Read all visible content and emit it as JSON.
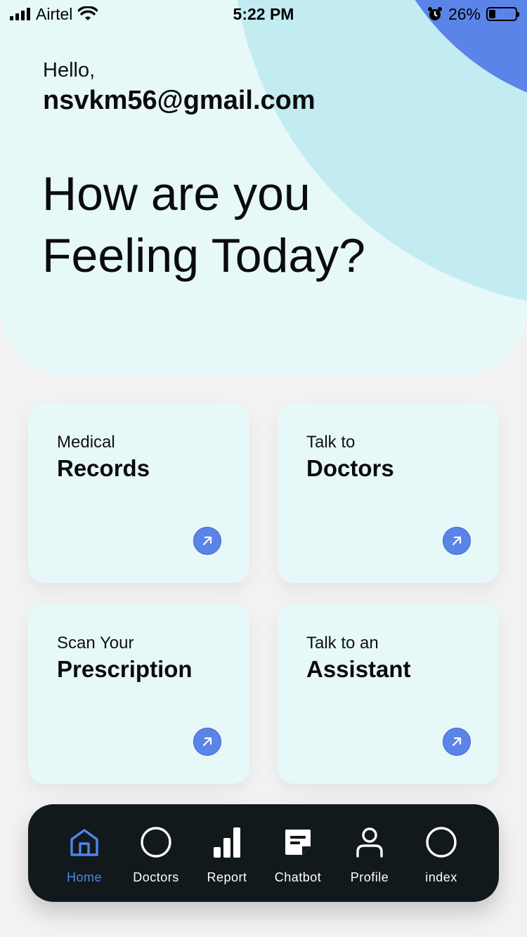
{
  "status_bar": {
    "carrier": "Airtel",
    "time": "5:22 PM",
    "battery": "26%",
    "battery_level": 0.26
  },
  "header": {
    "greeting": "Hello,",
    "user_email": "nsvkm56@gmail.com",
    "headline_line1": "How are you",
    "headline_line2": "Feeling Today?"
  },
  "cards": [
    {
      "small": "Medical",
      "big": "Records",
      "icon": "arrow-up-right-icon"
    },
    {
      "small": "Talk to",
      "big": "Doctors",
      "icon": "arrow-up-right-icon"
    },
    {
      "small": "Scan Your",
      "big": "Prescription",
      "icon": "arrow-up-right-icon"
    },
    {
      "small": "Talk to an",
      "big": "Assistant",
      "icon": "arrow-up-right-icon"
    }
  ],
  "nav": {
    "items": [
      {
        "label": "Home",
        "icon": "home-icon",
        "active": true
      },
      {
        "label": "Doctors",
        "icon": "circle-icon",
        "active": false
      },
      {
        "label": "Report",
        "icon": "bar-chart-icon",
        "active": false
      },
      {
        "label": "Chatbot",
        "icon": "note-icon",
        "active": false
      },
      {
        "label": "Profile",
        "icon": "person-icon",
        "active": false
      },
      {
        "label": "index",
        "icon": "circle-icon",
        "active": false
      }
    ]
  },
  "colors": {
    "accent": "#5b84e8",
    "card_bg": "#e7f8f9",
    "nav_bg": "#12191c",
    "nav_active": "#4d86ea"
  }
}
